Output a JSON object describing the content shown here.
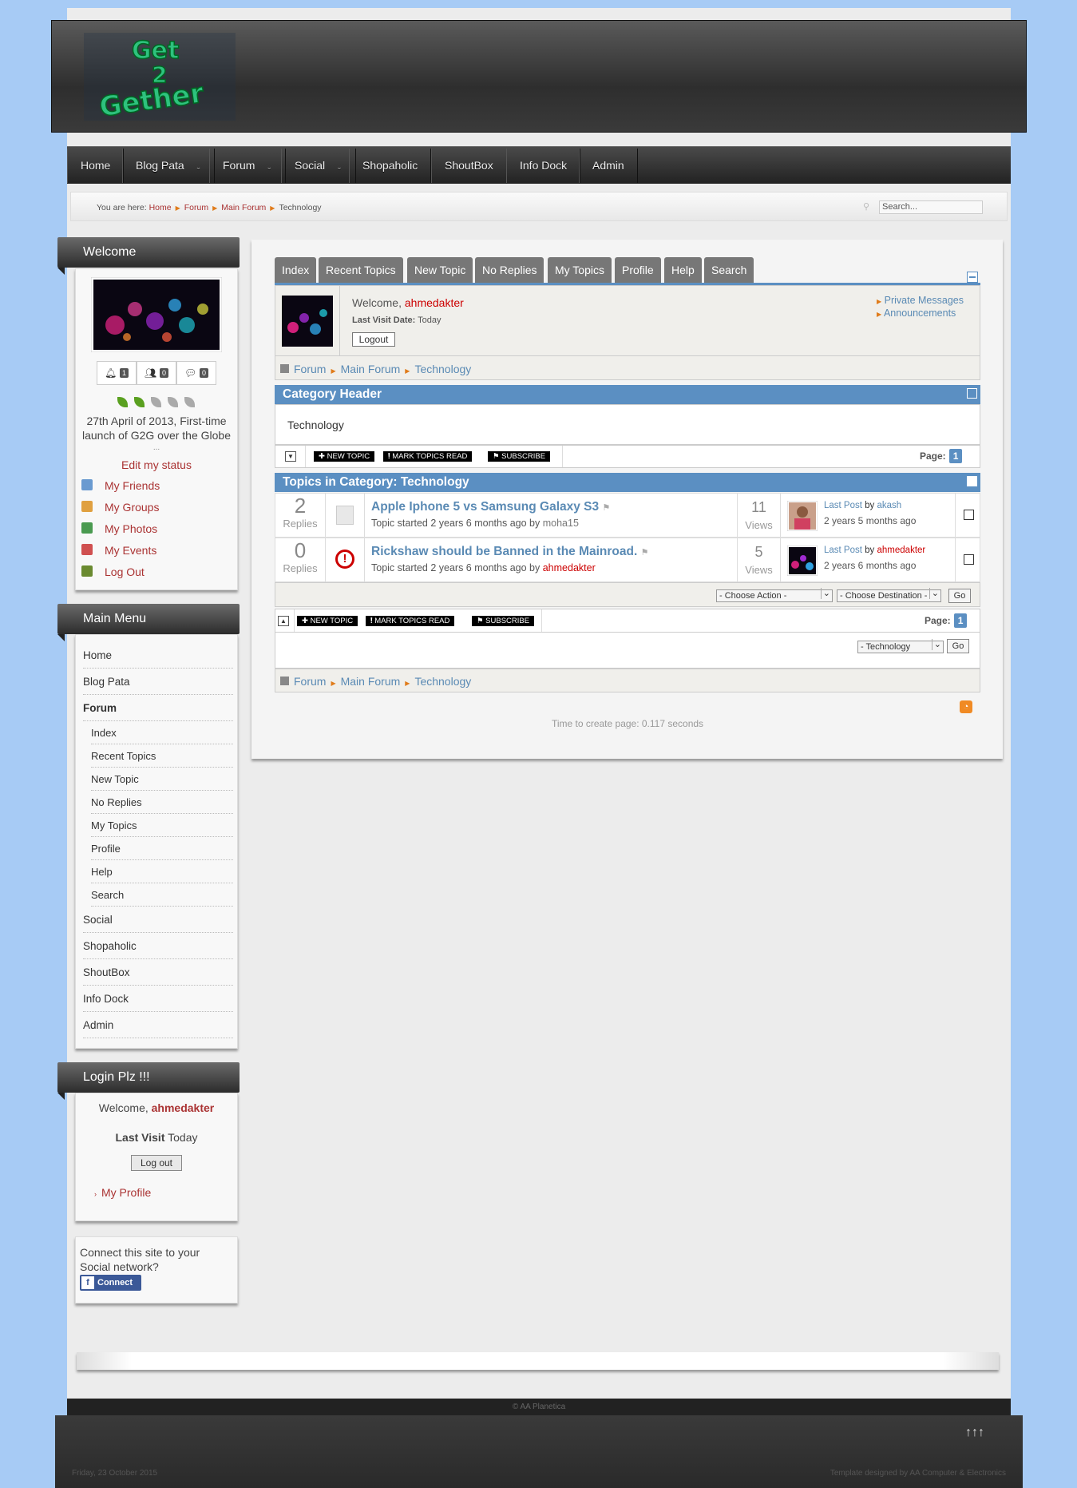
{
  "header": {
    "logo_text": "Get 2 Gether"
  },
  "nav": {
    "items": [
      "Home",
      "Blog Pata",
      "Forum",
      "Social",
      "Shopaholic",
      "ShoutBox",
      "Info Dock",
      "Admin"
    ]
  },
  "breadcrumb": {
    "prefix": "You are here:",
    "items": [
      "Home",
      "Forum",
      "Main Forum"
    ],
    "current": "Technology"
  },
  "search": {
    "placeholder": "Search..."
  },
  "welcome_module": {
    "title": "Welcome",
    "counts": [
      "1",
      "0",
      "0"
    ],
    "status": "27th April of 2013, First-time launch of G2G over the Globe",
    "ellipsis": "...",
    "edit_status": "Edit my status",
    "links": [
      "My Friends",
      "My Groups",
      "My Photos",
      "My Events",
      "Log Out"
    ]
  },
  "main_menu": {
    "title": "Main Menu",
    "items": [
      "Home",
      "Blog Pata",
      "Forum",
      "Index",
      "Recent Topics",
      "New Topic",
      "No Replies",
      "My Topics",
      "Profile",
      "Help",
      "Search",
      "Social",
      "Shopaholic",
      "ShoutBox",
      "Info Dock",
      "Admin"
    ]
  },
  "login_module": {
    "title": "Login Plz !!!",
    "welcome": "Welcome,",
    "user": "ahmedakter",
    "last_visit_label": "Last Visit",
    "last_visit_value": "Today",
    "logout": "Log out",
    "profile": "My Profile"
  },
  "connect": {
    "text": "Connect this site to your Social network?",
    "button": "Connect"
  },
  "forum": {
    "tabs": [
      "Index",
      "Recent Topics",
      "New Topic",
      "No Replies",
      "My Topics",
      "Profile",
      "Help",
      "Search"
    ],
    "welcome": "Welcome,",
    "user": "ahmedakter",
    "last_visit_label": "Last Visit Date:",
    "last_visit_value": "Today",
    "logout": "Logout",
    "side_links": [
      "Private Messages",
      "Announcements"
    ],
    "path": [
      "Forum",
      "Main Forum",
      "Technology"
    ],
    "category_header": "Category Header",
    "category_name": "Technology",
    "buttons": [
      "NEW TOPIC",
      "MARK TOPICS READ",
      "SUBSCRIBE"
    ],
    "page_label": "Page:",
    "page_num": "1",
    "topics_header": "Topics in Category: Technology",
    "topics": [
      {
        "replies": "2",
        "replies_label": "Replies",
        "title": "Apple Iphone 5 vs Samsung Galaxy S3",
        "started": "Topic started 2 years 6 months ago",
        "by": "by",
        "author": "moha15",
        "views": "11",
        "views_label": "Views",
        "last_post": "Last Post",
        "last_by": "by",
        "last_author": "akash",
        "last_time": "2 years 5 months ago"
      },
      {
        "replies": "0",
        "replies_label": "Replies",
        "title": "Rickshaw should be Banned in the Mainroad.",
        "started": "Topic started 2 years 6 months ago",
        "by": "by",
        "author": "ahmedakter",
        "views": "5",
        "views_label": "Views",
        "last_post": "Last Post",
        "last_by": "by",
        "last_author": "ahmedakter",
        "last_time": "2 years 6 months ago"
      }
    ],
    "choose_action": "- Choose Action -",
    "choose_dest": "- Choose Destination -",
    "go": "Go",
    "jump": "- Technology",
    "time": "Time to create page: 0.117 seconds"
  },
  "footer": {
    "copyright": "© AA Planetica",
    "top": "↑↑↑",
    "date": "Friday, 23 October 2015",
    "credit": "Template designed by AA Computer & Electronics"
  },
  "colors": {
    "accent": "#5b8fc2",
    "link_red": "#a33333",
    "bg": "#a7cbf5"
  }
}
